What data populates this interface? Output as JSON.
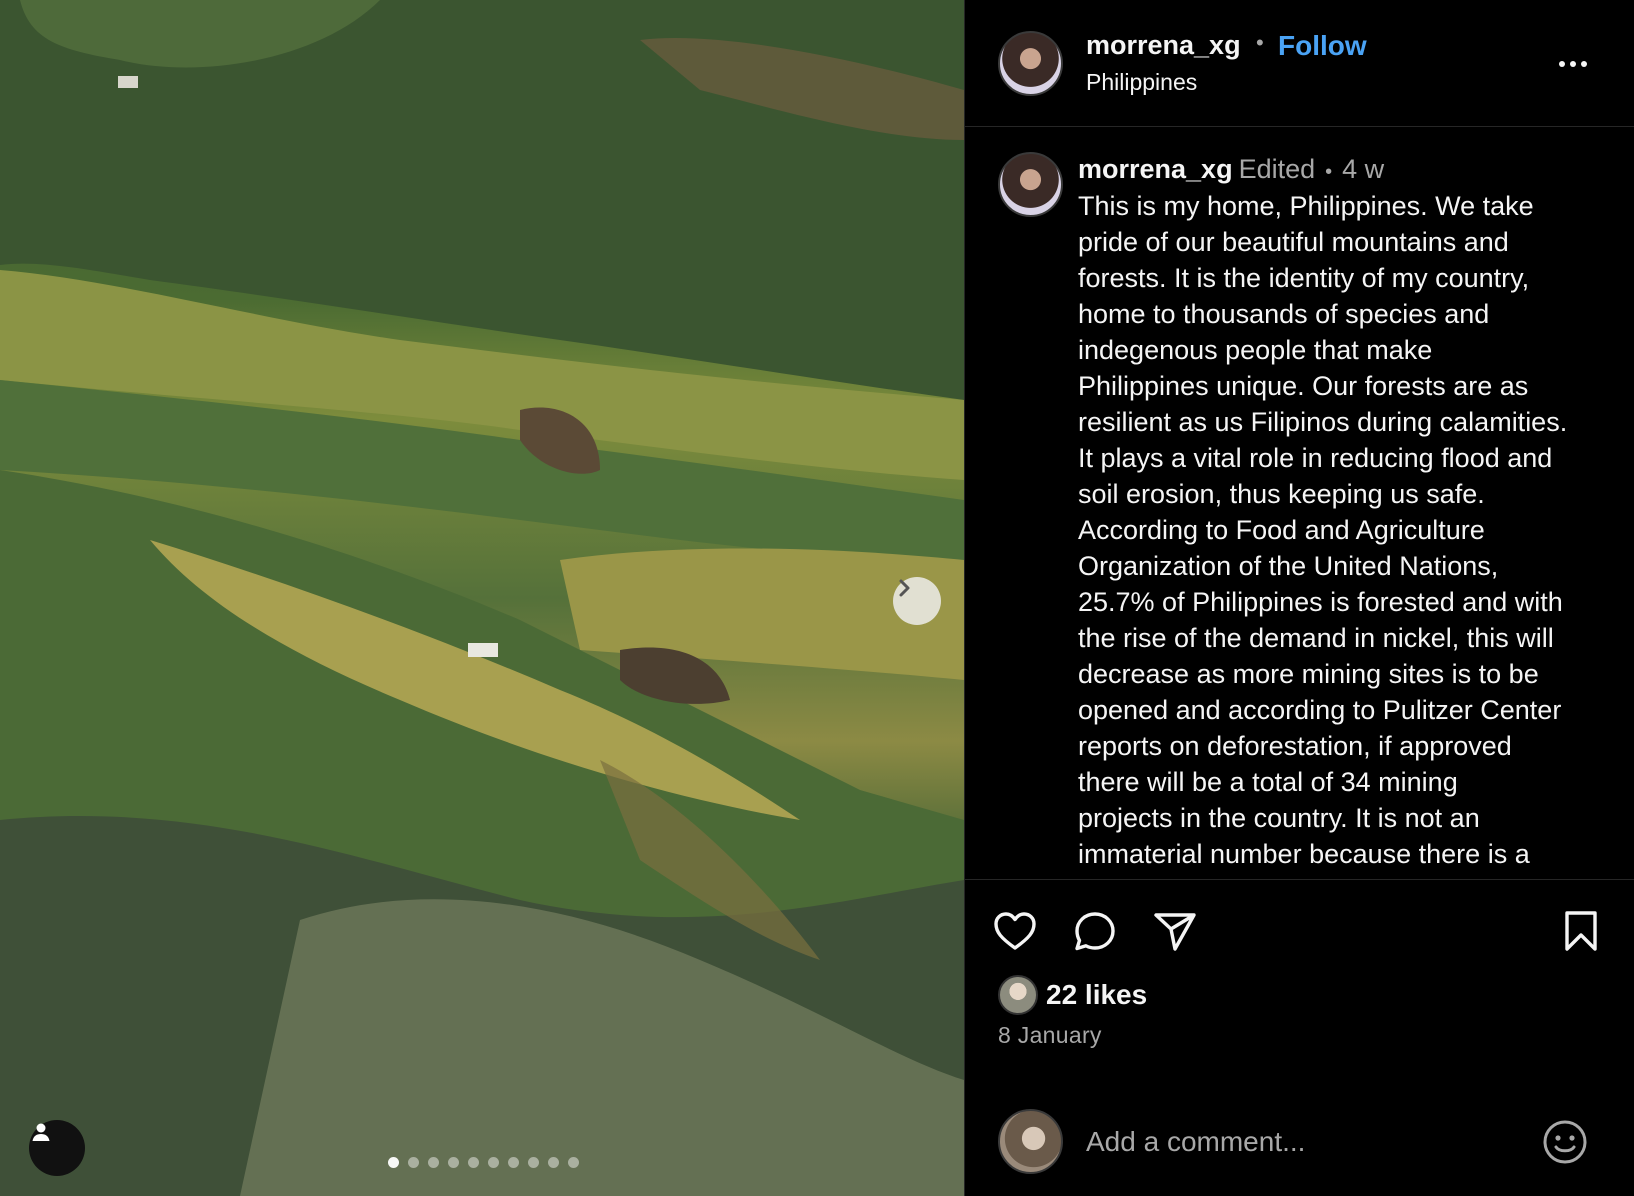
{
  "post": {
    "username": "morrena_xg",
    "separator": "•",
    "follow_label": "Follow",
    "location": "Philippines",
    "caption": {
      "username": "morrena_xg",
      "edited": "Edited",
      "separator": "•",
      "time": "4 w",
      "text": "This is my home, Philippines. We take\npride of our beautiful mountains and\nforests. It is the identity of my country,\nhome to thousands of species and\nindegenous people that make\nPhilippines unique. Our forests are as\nresilient as us Filipinos during calamities.\nIt plays a vital role in reducing flood and\nsoil erosion, thus keeping us safe.\nAccording to Food and Agriculture\nOrganization of the United Nations,\n25.7% of Philippines is forested and with\nthe rise of the demand in nickel, this will\ndecrease as more mining sites is to be\nopened and according to Pulitzer Center\nreports on deforestation, if approved\nthere will be a total of 34 mining\nprojects in the country. It is not an\nimmaterial number because there is a"
    },
    "likes": "22 likes",
    "date": "8 January",
    "comment_placeholder": "Add a comment..."
  },
  "media": {
    "carousel_count": 10,
    "carousel_active_index": 0,
    "next_icon": "chevron-right-icon",
    "user_tag_icon": "person-icon"
  },
  "icons": {
    "more": "more-horizontal-icon",
    "like": "heart-icon",
    "comment": "comment-bubble-icon",
    "share": "paper-plane-icon",
    "save": "bookmark-icon",
    "emoji": "smiley-icon"
  },
  "colors": {
    "background": "#000000",
    "text": "#f5f5f5",
    "secondary_text": "#a8a8a8",
    "follow_accent": "#4aa3f5",
    "divider": "#262626"
  }
}
